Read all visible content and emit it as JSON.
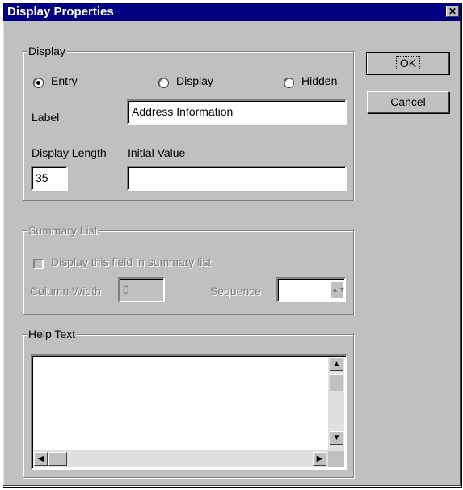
{
  "window": {
    "title": "Display Properties",
    "close_glyph": "✕"
  },
  "buttons": {
    "ok": "OK",
    "cancel": "Cancel"
  },
  "display_group": {
    "legend": "Display",
    "radios": [
      {
        "label": "Entry",
        "checked": true
      },
      {
        "label": "Display",
        "checked": false
      },
      {
        "label": "Hidden",
        "checked": false
      }
    ],
    "label_caption": "Label",
    "label_value": "Address Information",
    "display_length_caption": "Display Length",
    "display_length_value": "35",
    "initial_value_caption": "Initial Value",
    "initial_value_value": ""
  },
  "summary_group": {
    "legend": "Summary List",
    "checkbox_label": "Display this field in summary list",
    "column_width_caption": "Column Width",
    "column_width_value": "0",
    "sequence_caption": "Sequence",
    "sequence_value": ""
  },
  "help_group": {
    "legend": "Help Text",
    "text": "",
    "icons": {
      "up": "up-arrow",
      "down": "down-arrow",
      "left": "left-arrow",
      "right": "right-arrow"
    }
  }
}
